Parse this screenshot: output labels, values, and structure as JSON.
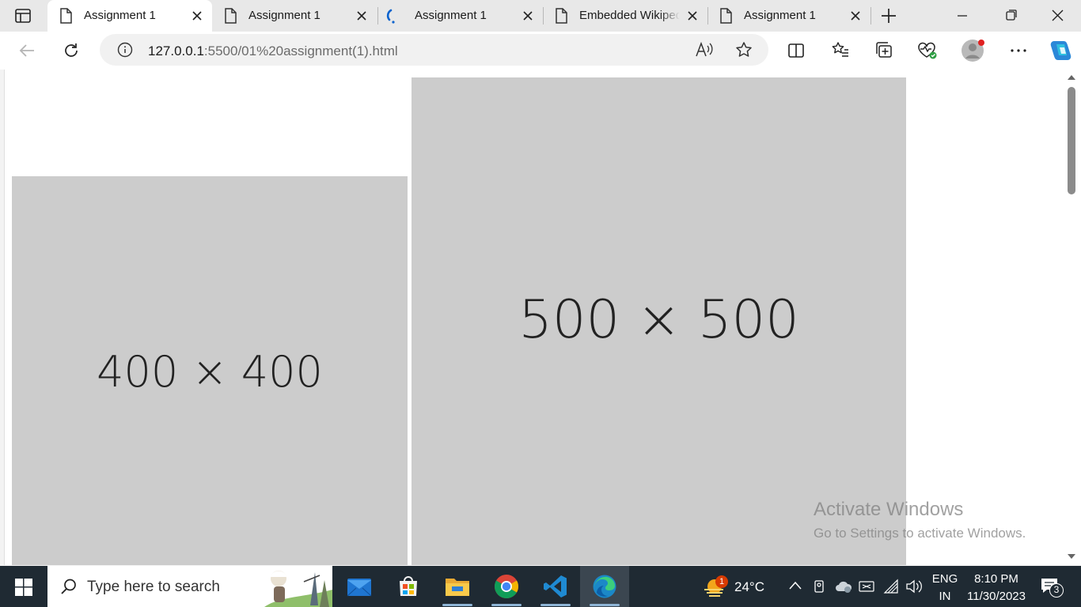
{
  "tabs": [
    {
      "title": "Assignment 1",
      "icon": "page-icon",
      "active": true
    },
    {
      "title": "Assignment 1",
      "icon": "page-icon",
      "active": false
    },
    {
      "title": "Assignment 1",
      "icon": "loading-icon",
      "active": false
    },
    {
      "title": "Embedded Wikipedia",
      "icon": "page-icon",
      "active": false
    },
    {
      "title": "Assignment 1",
      "icon": "page-icon",
      "active": false
    }
  ],
  "address_bar": {
    "url_host": "127.0.0.1",
    "url_rest": ":5500/01%20assignment(1).html"
  },
  "page": {
    "placeholder_small": "400 × 400",
    "placeholder_large": "500 × 500"
  },
  "watermark": {
    "title": "Activate Windows",
    "subtitle": "Go to Settings to activate Windows."
  },
  "taskbar": {
    "search_placeholder": "Type here to search",
    "weather_temp": "24°C",
    "weather_badge": "1",
    "language_line1": "ENG",
    "language_line2": "IN",
    "time": "8:10 PM",
    "date": "11/30/2023",
    "notification_count": "3"
  },
  "colors": {
    "accent_edge": "#0c63ce",
    "placeholder_bg": "#cccccc",
    "taskbar_bg": "#1f2a33"
  }
}
